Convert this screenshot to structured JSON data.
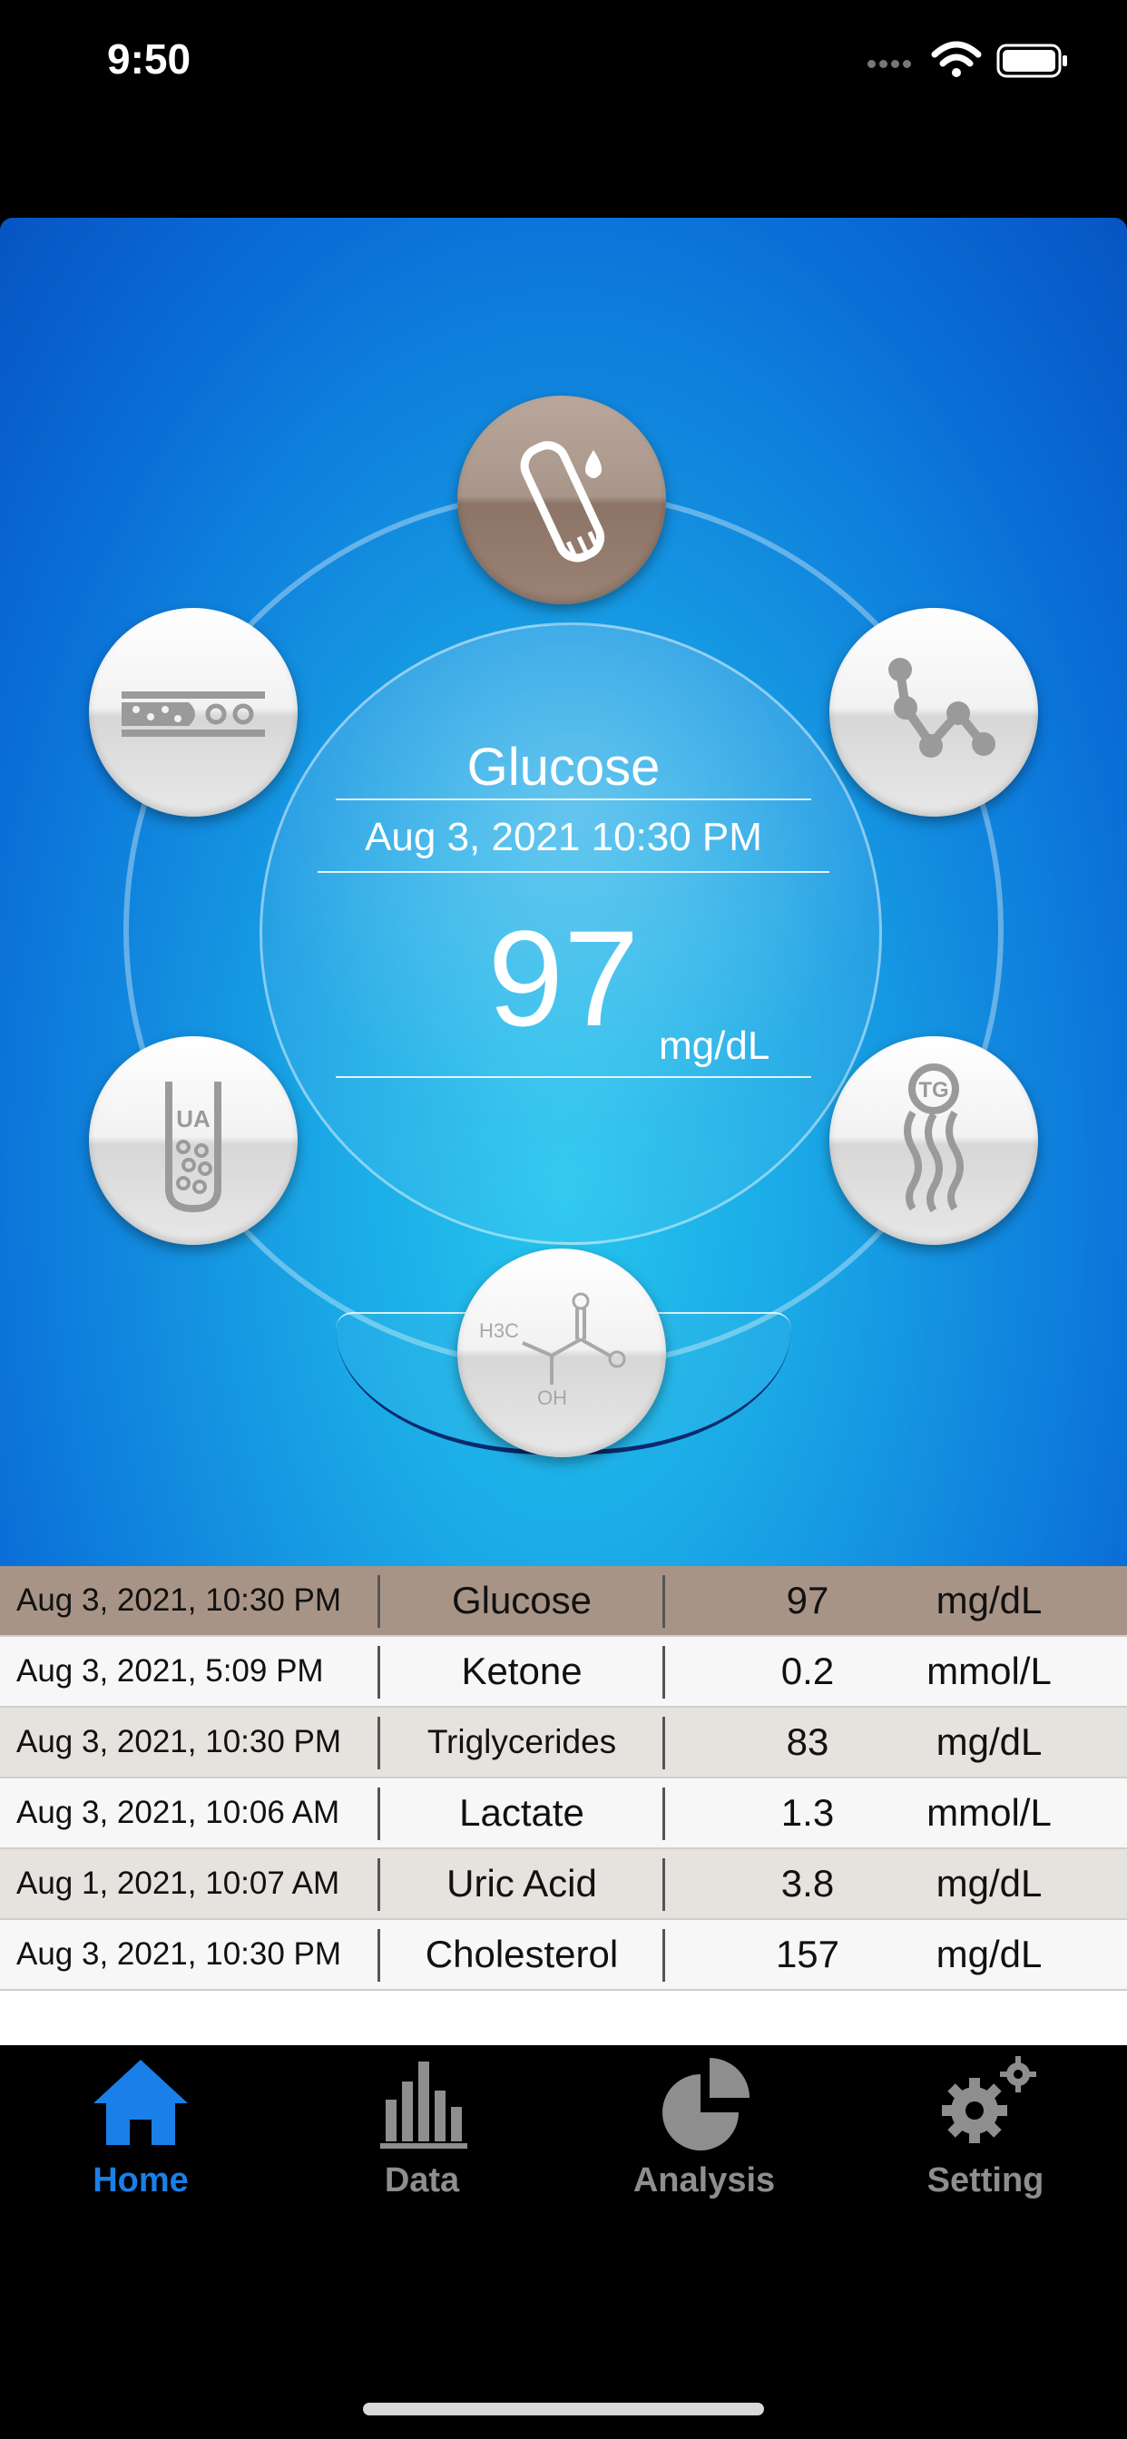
{
  "status_bar": {
    "time": "9:50"
  },
  "reading": {
    "title": "Glucose",
    "datetime": "Aug 3, 2021 10:30 PM",
    "value": "97",
    "unit": "mg/dL"
  },
  "test_types": [
    {
      "name": "glucose-strip",
      "active": true
    },
    {
      "name": "ketone",
      "active": false
    },
    {
      "name": "triglycerides",
      "active": false,
      "icon_text": "TG"
    },
    {
      "name": "lactate",
      "active": false,
      "icon_text_top": "H3C",
      "icon_text_bottom": "OH"
    },
    {
      "name": "uric-acid",
      "active": false,
      "icon_text": "UA"
    },
    {
      "name": "cholesterol",
      "active": false
    }
  ],
  "records": [
    {
      "date": "Aug 3, 2021, 10:30 PM",
      "test": "Glucose",
      "value": "97",
      "unit": "mg/dL",
      "selected": true
    },
    {
      "date": "Aug 3, 2021, 5:09 PM",
      "test": "Ketone",
      "value": "0.2",
      "unit": "mmol/L"
    },
    {
      "date": "Aug 3, 2021, 10:30 PM",
      "test": "Triglycerides",
      "value": "83",
      "unit": "mg/dL"
    },
    {
      "date": "Aug 3, 2021, 10:06 AM",
      "test": "Lactate",
      "value": "1.3",
      "unit": "mmol/L"
    },
    {
      "date": "Aug 1, 2021, 10:07 AM",
      "test": "Uric Acid",
      "value": "3.8",
      "unit": "mg/dL"
    },
    {
      "date": "Aug 3, 2021, 10:30 PM",
      "test": "Cholesterol",
      "value": "157",
      "unit": "mg/dL"
    }
  ],
  "tabs": [
    {
      "label": "Home",
      "icon": "home-icon",
      "active": true
    },
    {
      "label": "Data",
      "icon": "bar-chart-icon",
      "active": false
    },
    {
      "label": "Analysis",
      "icon": "pie-chart-icon",
      "active": false
    },
    {
      "label": "Setting",
      "icon": "gears-icon",
      "active": false
    }
  ],
  "colors": {
    "accent": "#1a7fe8",
    "selected_row": "#a89486",
    "inactive_tab": "#8e8e8e"
  }
}
